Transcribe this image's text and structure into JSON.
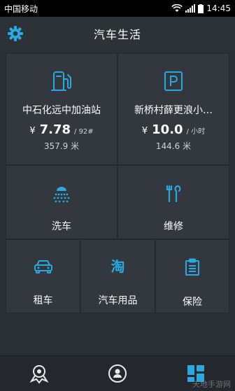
{
  "status_bar": {
    "carrier": "中国移动",
    "time": "14:45"
  },
  "header": {
    "title": "汽车生活",
    "settings_icon": "gear-icon"
  },
  "colors": {
    "accent": "#2aa8e0",
    "background": "#2b3035",
    "tile": "#32383d"
  },
  "gas_station": {
    "name": "中石化远中加油站",
    "currency": "¥",
    "price": "7.78",
    "unit": "/ 92#",
    "distance": "357.9 米",
    "icon": "fuel-pump-icon"
  },
  "parking": {
    "name": "新桥村薛更浪小…",
    "currency": "¥",
    "price": "10.0",
    "unit": "/ 小时",
    "distance": "144.6 米",
    "icon": "parking-icon"
  },
  "services": [
    {
      "label": "洗车",
      "icon": "car-wash-icon"
    },
    {
      "label": "维修",
      "icon": "repair-tools-icon"
    },
    {
      "label": "租车",
      "icon": "rental-car-icon"
    },
    {
      "label": "汽车用品",
      "icon": "taobao-icon"
    },
    {
      "label": "保险",
      "icon": "insurance-clipboard-icon"
    }
  ],
  "bottom_nav": [
    {
      "icon": "map-pin-icon",
      "active": false
    },
    {
      "icon": "user-profile-icon",
      "active": false
    },
    {
      "icon": "grid-apps-icon",
      "active": true
    }
  ],
  "watermark": "天地手游网"
}
